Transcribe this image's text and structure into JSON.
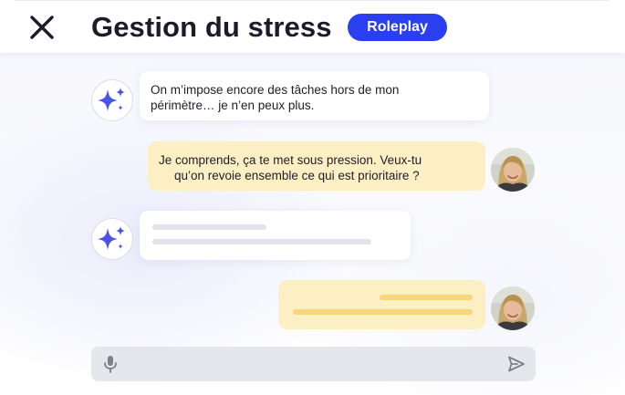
{
  "header": {
    "title": "Gestion du stress",
    "badge": "Roleplay",
    "close_icon": "close-icon"
  },
  "colors": {
    "accent": "#2a3ff0",
    "user_bubble": "#fdefc4",
    "ai_bubble": "#ffffff",
    "sparkle": "#4a52e8"
  },
  "messages": [
    {
      "role": "assistant",
      "icon": "sparkle-icon",
      "lines": [
        "On m’impose encore des tâches hors de mon",
        "périmètre… je n’en peux plus."
      ]
    },
    {
      "role": "user",
      "avatar": "user-avatar",
      "lines": [
        "Je comprends, ça te met sous pression. Veux-tu",
        "qu’on revoie ensemble ce qui est prioritaire ?"
      ]
    },
    {
      "role": "assistant",
      "icon": "sparkle-icon",
      "pending": true
    },
    {
      "role": "user",
      "avatar": "user-avatar",
      "pending": true
    }
  ],
  "composer": {
    "mic_icon": "microphone-icon",
    "send_icon": "send-icon"
  }
}
